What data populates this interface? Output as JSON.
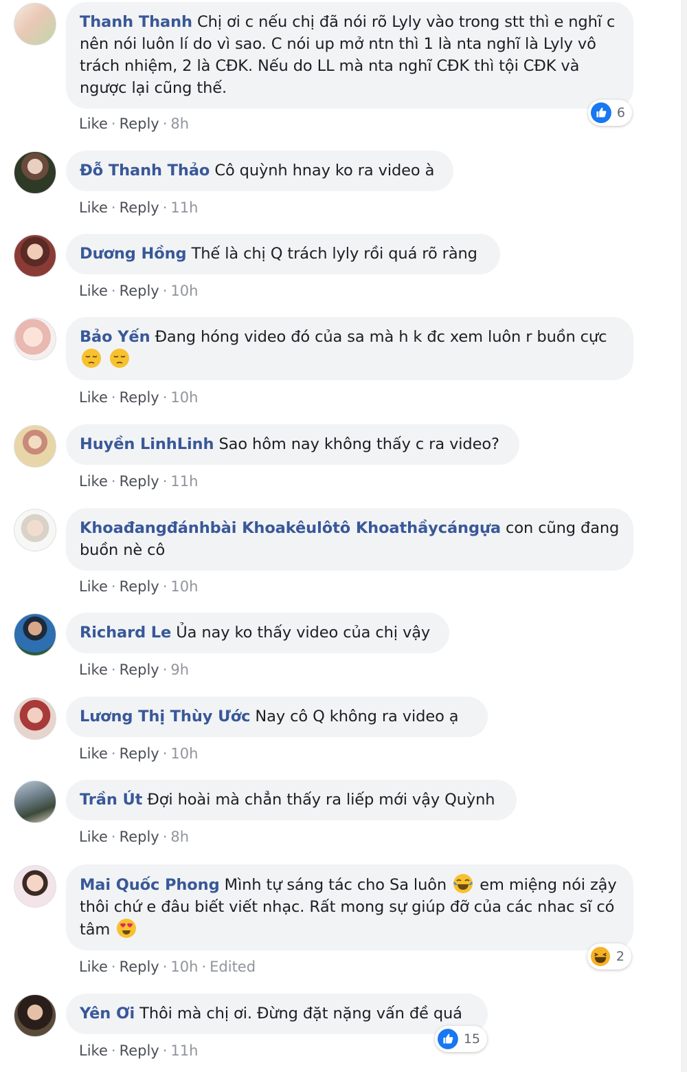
{
  "actions": {
    "like": "Like",
    "reply": "Reply"
  },
  "comments": [
    {
      "author": "Thanh Thanh",
      "text": "Chị ơi c nếu chị đã nói rõ Lyly vào trong stt thì e nghĩ c nên nói luôn lí do vì sao. C nói up mở ntn thì 1 là nta nghĩ là Lyly vô trách nhiệm, 2 là CĐK. Nếu do LL mà nta nghĩ CĐK thì tội CĐK và ngược lại cũng thế.",
      "time": "8h",
      "reaction_count": "6"
    },
    {
      "author": "Đỗ Thanh Thảo",
      "text": "Cô quỳnh hnay ko ra video à",
      "time": "11h"
    },
    {
      "author": "Dương Hồng",
      "text": "Thế là chị Q trách lyly rồi quá rõ ràng",
      "time": "10h"
    },
    {
      "author": "Bảo Yến",
      "text": "Đang hóng video đó của sa mà h k đc xem luôn r buồn cực",
      "time": "10h"
    },
    {
      "author": "Huyền LinhLinh",
      "text": "Sao hôm nay không thấy c ra video?",
      "time": "11h"
    },
    {
      "author": "Khoađangđánhbài Khoakêulôtô Khoathầycángựa",
      "text": "con cũng đang buồn nè cô",
      "time": "10h"
    },
    {
      "author": "Richard Le",
      "text": "Ủa nay ko thấy video của chị vậy",
      "time": "9h"
    },
    {
      "author": "Lương Thị Thùy Ước",
      "text": "Nay cô Q không ra video ạ",
      "time": "10h"
    },
    {
      "author": "Trần Út",
      "text": "Đợi hoài mà chẳn thấy ra liếp mới vậy Quỳnh",
      "time": "8h"
    },
    {
      "author": "Mai Quốc Phong",
      "text_a": "Mình tự sáng tác cho Sa luôn",
      "text_b": "em miệng nói zậy thôi chứ e đâu biết viết nhạc. Rất mong sự giúp đỡ của các nhac sĩ có tâm",
      "time": "10h",
      "edited": "Edited",
      "reaction_count": "2"
    },
    {
      "author": "Yên Ơi",
      "text": "Thôi mà chị ơi. Đừng đặt nặng vấn đề quá",
      "time": "11h",
      "reaction_count": "15"
    }
  ],
  "icons": {
    "avatar": "avatar-photo",
    "like_reaction": "like-reaction-icon",
    "haha_reaction": "haha-reaction-icon",
    "sad_emoji": "pensive-face-emoji",
    "laugh_emoji": "tears-of-joy-emoji",
    "heart_eyes_emoji": "heart-eyes-emoji"
  },
  "colors": {
    "author": "#385898",
    "bubble": "#f2f3f5",
    "meta": "#90949c",
    "like_blue": "#1877f2",
    "haha_yellow": "#f7b125"
  }
}
